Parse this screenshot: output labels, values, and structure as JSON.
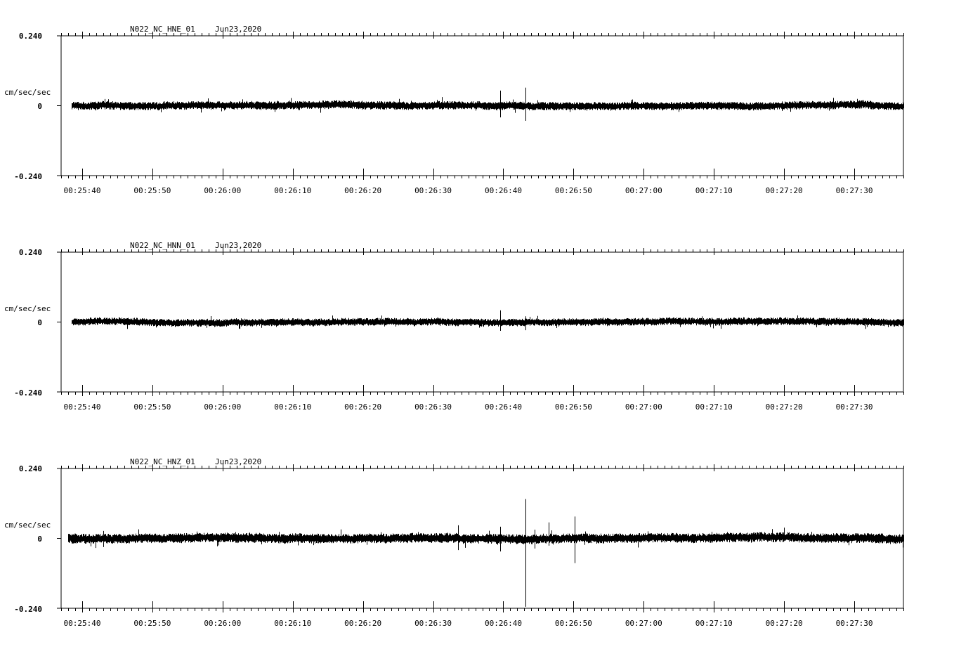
{
  "chart_data": [
    {
      "type": "line",
      "title": "N022_NC_HNE_01",
      "date": "Jun23,2020",
      "ylabel": "cm/sec/sec",
      "ylim": [
        -0.24,
        0.24
      ],
      "yticks": [
        {
          "label": "0.240",
          "value": 0.24
        },
        {
          "label": "0",
          "value": 0
        },
        {
          "label": "-0.240",
          "value": -0.24
        }
      ],
      "xlim": [
        "00:25:37",
        "00:27:37"
      ],
      "xticks": [
        "00:25:40",
        "00:25:50",
        "00:26:00",
        "00:26:10",
        "00:26:20",
        "00:26:30",
        "00:26:40",
        "00:26:50",
        "00:27:00",
        "00:27:10",
        "00:27:20",
        "00:27:30"
      ],
      "series": [
        {
          "start": "00:25:38.5",
          "end": "00:27:37",
          "noise_amplitude": 0.012,
          "spikes": [
            {
              "t": "00:26:39.6",
              "max": 0.052,
              "min": -0.04
            },
            {
              "t": "00:26:43.2",
              "max": 0.062,
              "min": -0.052
            },
            {
              "t": "00:26:31.2",
              "max": 0.03,
              "min": -0.014
            }
          ]
        }
      ]
    },
    {
      "type": "line",
      "title": "N022_NC_HNN_01",
      "date": "Jun23,2020",
      "ylabel": "cm/sec/sec",
      "ylim": [
        -0.24,
        0.24
      ],
      "yticks": [
        {
          "label": "0.240",
          "value": 0.24
        },
        {
          "label": "0",
          "value": 0
        },
        {
          "label": "-0.240",
          "value": -0.24
        }
      ],
      "xlim": [
        "00:25:37",
        "00:27:37"
      ],
      "xticks": [
        "00:25:40",
        "00:25:50",
        "00:26:00",
        "00:26:10",
        "00:26:20",
        "00:26:30",
        "00:26:40",
        "00:26:50",
        "00:27:00",
        "00:27:10",
        "00:27:20",
        "00:27:30"
      ],
      "series": [
        {
          "start": "00:25:38.5",
          "end": "00:27:37",
          "noise_amplitude": 0.011,
          "spikes": [
            {
              "t": "00:26:39.6",
              "max": 0.04,
              "min": -0.03
            },
            {
              "t": "00:26:43.2",
              "max": 0.02,
              "min": -0.028
            }
          ]
        }
      ]
    },
    {
      "type": "line",
      "title": "N022_NC_HNZ_01",
      "date": "Jun23,2020",
      "ylabel": "cm/sec/sec",
      "ylim": [
        -0.24,
        0.24
      ],
      "yticks": [
        {
          "label": "0.240",
          "value": 0.24
        },
        {
          "label": "0",
          "value": 0
        },
        {
          "label": "-0.240",
          "value": -0.24
        }
      ],
      "xlim": [
        "00:25:37",
        "00:27:37"
      ],
      "xticks": [
        "00:25:40",
        "00:25:50",
        "00:26:00",
        "00:26:10",
        "00:26:20",
        "00:26:30",
        "00:26:40",
        "00:26:50",
        "00:27:00",
        "00:27:10",
        "00:27:20",
        "00:27:30"
      ],
      "series": [
        {
          "start": "00:25:38",
          "end": "00:27:37",
          "noise_amplitude": 0.014,
          "spikes": [
            {
              "t": "00:26:43.2",
              "max": 0.135,
              "min": -0.235
            },
            {
              "t": "00:26:39.6",
              "max": 0.04,
              "min": -0.045
            },
            {
              "t": "00:26:46.5",
              "max": 0.055,
              "min": -0.025
            },
            {
              "t": "00:26:50.2",
              "max": 0.075,
              "min": -0.085
            },
            {
              "t": "00:26:33.5",
              "max": 0.045,
              "min": -0.04
            },
            {
              "t": "00:26:44.5",
              "max": 0.03,
              "min": -0.035
            }
          ]
        }
      ]
    }
  ]
}
